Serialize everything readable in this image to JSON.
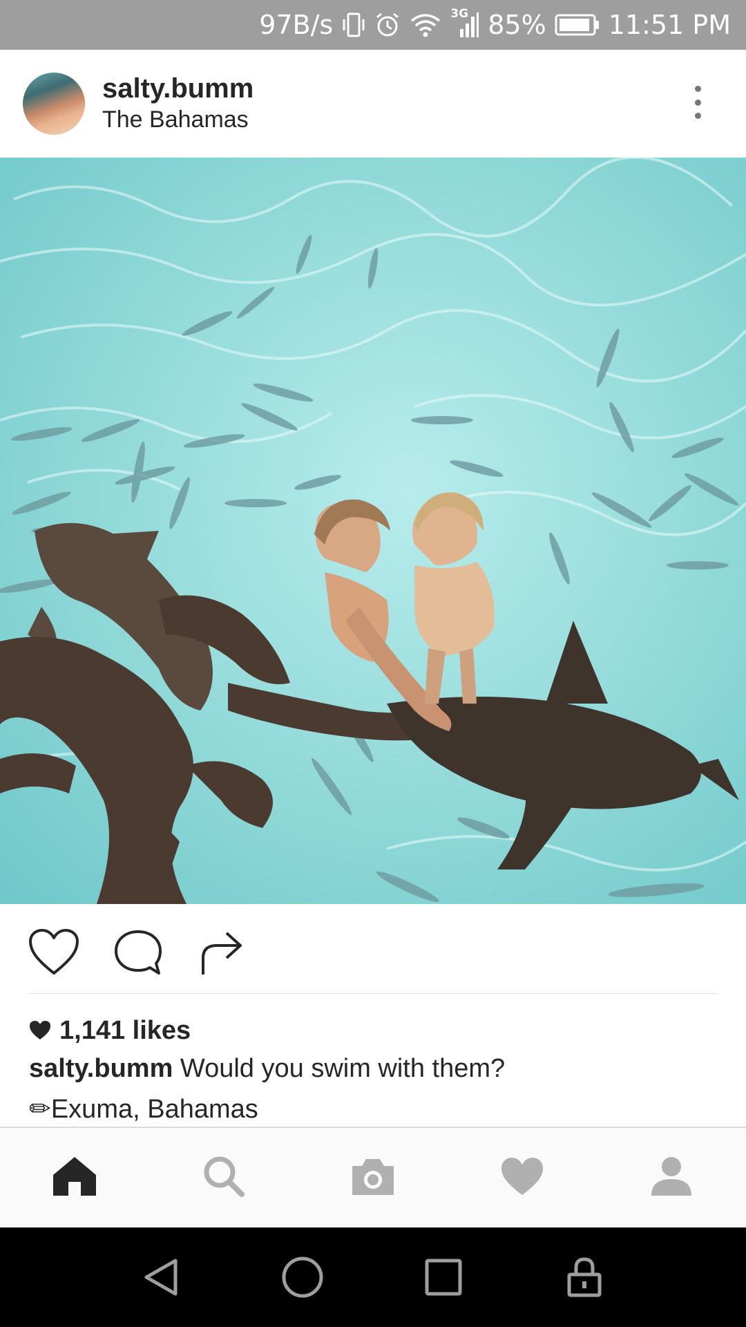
{
  "status_bar": {
    "net_speed": "97B/s",
    "network_type": "3G",
    "battery": "85%",
    "time": "11:51 PM",
    "icons": [
      "vibrate-icon",
      "alarm-icon",
      "wifi-icon",
      "signal-icon",
      "battery-icon"
    ]
  },
  "post": {
    "username": "salty.bumm",
    "location": "The Bahamas",
    "image_icon": "photo-sharks-swimmers",
    "likes": "1,141 likes",
    "caption_user": "salty.bumm",
    "caption_text": " Would you swim with them?",
    "caption_location": "✏Exuma, Bahamas"
  },
  "actions": {
    "icons": [
      "heart-outline-icon",
      "comment-icon",
      "share-icon"
    ]
  },
  "bottom_nav": {
    "items": [
      "home",
      "search",
      "camera",
      "activity",
      "profile"
    ],
    "active": "home"
  },
  "system_nav": {
    "buttons": [
      "back",
      "home",
      "recents",
      "lock"
    ]
  },
  "colors": {
    "status_bar": "#9e9e9e",
    "text": "#262626",
    "nav_background": "#fafafa",
    "inactive_icon": "#b0b0b0",
    "water": "#8fd8d8"
  }
}
